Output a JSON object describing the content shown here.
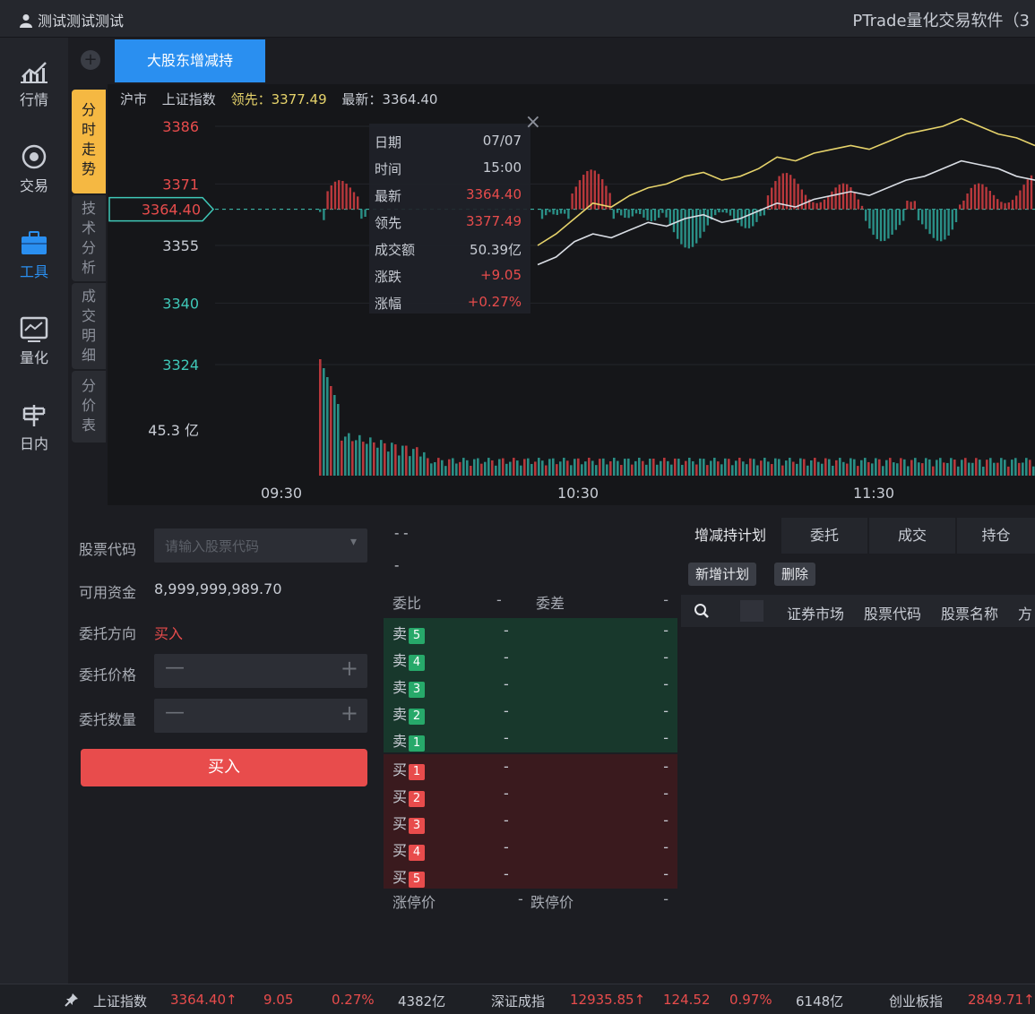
{
  "titlebar": {
    "user": "测试测试测试",
    "app_title": "PTrade量化交易软件（3"
  },
  "nav": [
    {
      "label": "行情",
      "icon": "chart-line-icon"
    },
    {
      "label": "交易",
      "icon": "trade-icon"
    },
    {
      "label": "工具",
      "icon": "toolbox-icon"
    },
    {
      "label": "量化",
      "icon": "quant-icon"
    },
    {
      "label": "日内",
      "icon": "intraday-icon"
    }
  ],
  "tabs": {
    "active": "大股东增减持"
  },
  "vtabs": [
    "分时走势",
    "技术分析",
    "成交明细",
    "分价表"
  ],
  "chart_info": {
    "market": "沪市",
    "name": "上证指数",
    "lead": "领先：3377.49",
    "latest": "最新：3364.40"
  },
  "tooltip": [
    {
      "k": "日期",
      "v": "07/07",
      "red": false
    },
    {
      "k": "时间",
      "v": "15:00",
      "red": false
    },
    {
      "k": "最新",
      "v": "3364.40",
      "red": true
    },
    {
      "k": "领先",
      "v": "3377.49",
      "red": true
    },
    {
      "k": "成交额",
      "v": "50.39亿",
      "red": false
    },
    {
      "k": "涨跌",
      "v": "+9.05",
      "red": true
    },
    {
      "k": "涨幅",
      "v": "+0.27%",
      "red": true
    }
  ],
  "chart_data": {
    "type": "line",
    "y_ticks": [
      {
        "label": "3386",
        "value": 3386,
        "color": "#e84c4c"
      },
      {
        "label": "3371",
        "value": 3371,
        "color": "#e84c4c"
      },
      {
        "label": "3355",
        "value": 3355,
        "color": "#c8ccd4"
      },
      {
        "label": "3340",
        "value": 3340,
        "color": "#3fc8b8"
      },
      {
        "label": "3324",
        "value": 3324,
        "color": "#3fc8b8"
      }
    ],
    "current_price_label": "3364.40",
    "current_price": 3364.4,
    "volume_label": "45.3 亿",
    "x_ticks": [
      "09:30",
      "10:30",
      "11:30"
    ],
    "ylim": [
      3324,
      3386
    ],
    "series": [
      {
        "name": "最新",
        "color": "#d9dde4",
        "values": [
          3350,
          3352,
          3356,
          3358,
          3357,
          3359,
          3361,
          3360,
          3362,
          3363,
          3361,
          3362,
          3364,
          3366,
          3365,
          3367,
          3368,
          3369,
          3368,
          3370,
          3372,
          3373,
          3375,
          3377,
          3376,
          3375,
          3373,
          3372
        ]
      },
      {
        "name": "领先",
        "color": "#e6d36b",
        "values": [
          3355,
          3358,
          3362,
          3366,
          3365,
          3368,
          3370,
          3371,
          3373,
          3374,
          3372,
          3373,
          3375,
          3378,
          3377,
          3379,
          3380,
          3381,
          3380,
          3382,
          3384,
          3385,
          3386,
          3388,
          3386,
          3384,
          3383,
          3381
        ]
      }
    ]
  },
  "trade_form": {
    "code_label": "股票代码",
    "code_placeholder": "请输入股票代码",
    "funds_label": "可用资金",
    "funds_value": "8,999,999,989.70",
    "direction_label": "委托方向",
    "direction_value": "买入",
    "price_label": "委托价格",
    "qty_label": "委托数量",
    "minus": "—",
    "plus": "+",
    "buy_button": "买入"
  },
  "orderbook": {
    "dash1": "- -",
    "dash2": "-",
    "head_ratio": "委比",
    "head_ratio_val": "-",
    "head_diff": "委差",
    "head_diff_val": "-",
    "sell": [
      {
        "side": "卖",
        "lv": "5",
        "p": "-",
        "q": "-"
      },
      {
        "side": "卖",
        "lv": "4",
        "p": "-",
        "q": "-"
      },
      {
        "side": "卖",
        "lv": "3",
        "p": "-",
        "q": "-"
      },
      {
        "side": "卖",
        "lv": "2",
        "p": "-",
        "q": "-"
      },
      {
        "side": "卖",
        "lv": "1",
        "p": "-",
        "q": "-"
      }
    ],
    "buy": [
      {
        "side": "买",
        "lv": "1",
        "p": "-",
        "q": "-"
      },
      {
        "side": "买",
        "lv": "2",
        "p": "-",
        "q": "-"
      },
      {
        "side": "买",
        "lv": "3",
        "p": "-",
        "q": "-"
      },
      {
        "side": "买",
        "lv": "4",
        "p": "-",
        "q": "-"
      },
      {
        "side": "买",
        "lv": "5",
        "p": "-",
        "q": "-"
      }
    ],
    "limit_up": "涨停价",
    "limit_up_val": "-",
    "limit_down": "跌停价",
    "limit_down_val": "-"
  },
  "plan": {
    "tabs": [
      "增减持计划",
      "委托",
      "成交",
      "持仓"
    ],
    "new_button": "新增计划",
    "delete_button": "删除",
    "columns": [
      "证券市场",
      "股票代码",
      "股票名称",
      "方"
    ]
  },
  "statusbar": [
    {
      "name": "上证指数",
      "price": "3364.40↑",
      "chg": "9.05",
      "pct": "0.27%",
      "amt": "4382亿"
    },
    {
      "name": "深证成指",
      "price": "12935.85↑",
      "chg": "124.52",
      "pct": "0.97%",
      "amt": "6148亿"
    },
    {
      "name": "创业板指",
      "price": "2849.71↑"
    }
  ]
}
